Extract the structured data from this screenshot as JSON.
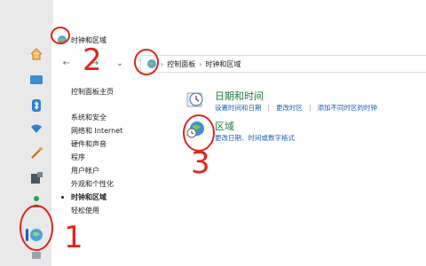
{
  "window": {
    "title": "时钟和区域"
  },
  "address_bar": {
    "crumbs": [
      "控制面板",
      "时钟和区域"
    ]
  },
  "left_nav": {
    "home": "控制面板主页",
    "items": [
      {
        "label": "系统和安全",
        "active": false
      },
      {
        "label": "网络和 Internet",
        "active": false
      },
      {
        "label": "硬件和声音",
        "active": false
      },
      {
        "label": "程序",
        "active": false
      },
      {
        "label": "用户帐户",
        "active": false
      },
      {
        "label": "外观和个性化",
        "active": false
      },
      {
        "label": "时钟和区域",
        "active": true
      },
      {
        "label": "轻松使用",
        "active": false
      }
    ]
  },
  "categories": [
    {
      "title": "日期和时间",
      "icon": "clock-icon",
      "links": [
        "设置时间和日期",
        "更改时区",
        "添加不同时区的时钟"
      ]
    },
    {
      "title": "区域",
      "icon": "globe-clock-icon",
      "links": [
        "更改日期、时间或数字格式"
      ]
    }
  ],
  "annotations": {
    "n1": "1",
    "n2": "2",
    "n3": "3"
  },
  "colors": {
    "annotation": "#e0261a",
    "link": "#1a5fb4",
    "category_title": "#1d7a3a"
  }
}
